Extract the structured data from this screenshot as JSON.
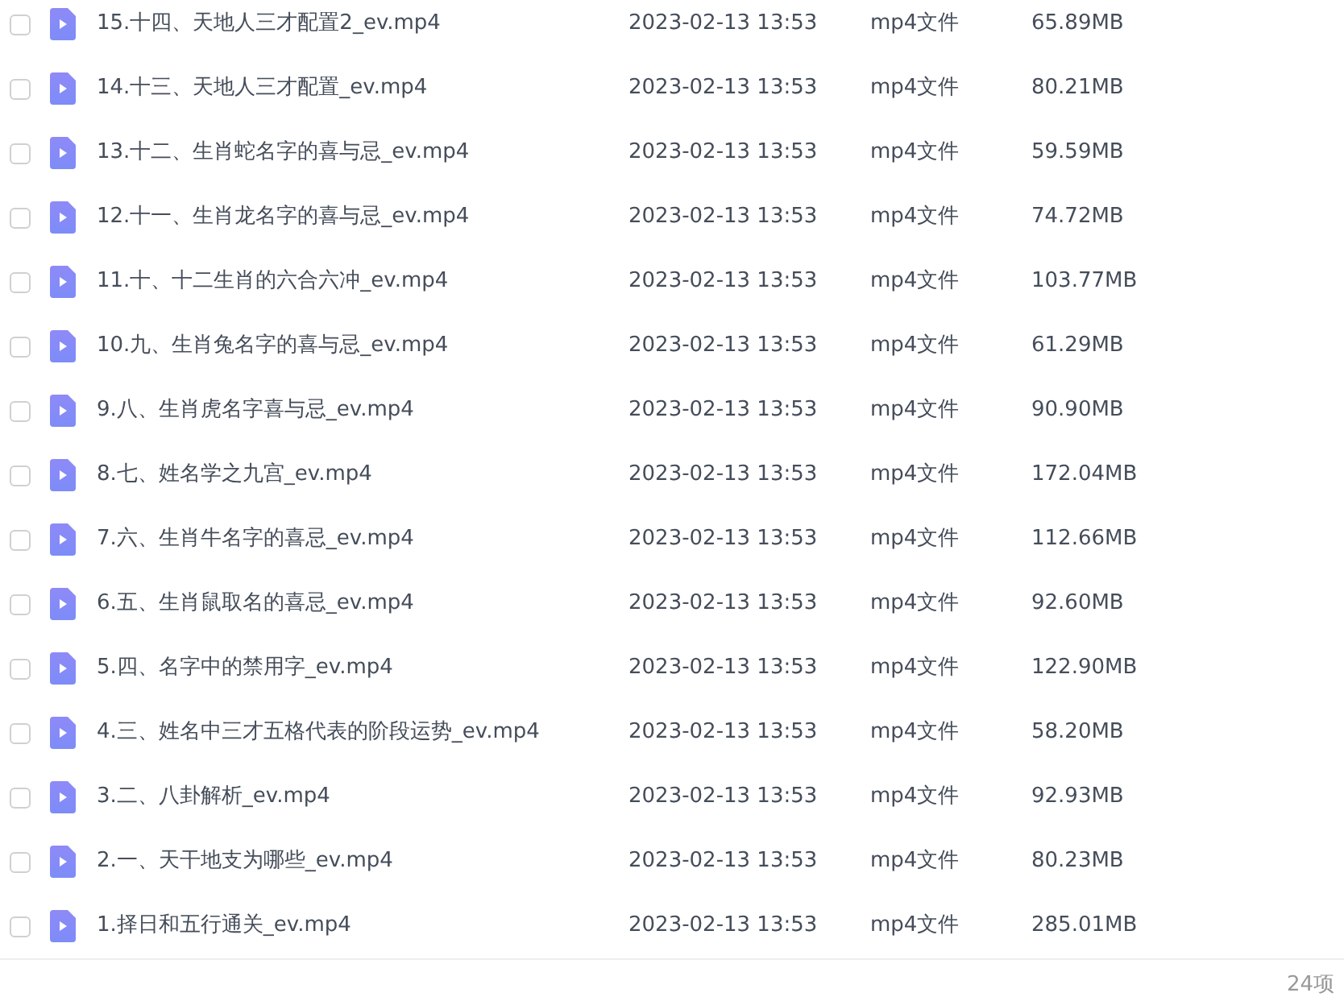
{
  "files": [
    {
      "name": "15.十四、天地人三才配置2_ev.mp4",
      "modified": "2023-02-13 13:53",
      "type": "mp4文件",
      "size": "65.89MB",
      "checked": false
    },
    {
      "name": "14.十三、天地人三才配置_ev.mp4",
      "modified": "2023-02-13 13:53",
      "type": "mp4文件",
      "size": "80.21MB",
      "checked": false
    },
    {
      "name": "13.十二、生肖蛇名字的喜与忌_ev.mp4",
      "modified": "2023-02-13 13:53",
      "type": "mp4文件",
      "size": "59.59MB",
      "checked": false
    },
    {
      "name": "12.十一、生肖龙名字的喜与忌_ev.mp4",
      "modified": "2023-02-13 13:53",
      "type": "mp4文件",
      "size": "74.72MB",
      "checked": false
    },
    {
      "name": "11.十、十二生肖的六合六冲_ev.mp4",
      "modified": "2023-02-13 13:53",
      "type": "mp4文件",
      "size": "103.77MB",
      "checked": false
    },
    {
      "name": "10.九、生肖兔名字的喜与忌_ev.mp4",
      "modified": "2023-02-13 13:53",
      "type": "mp4文件",
      "size": "61.29MB",
      "checked": false
    },
    {
      "name": "9.八、生肖虎名字喜与忌_ev.mp4",
      "modified": "2023-02-13 13:53",
      "type": "mp4文件",
      "size": "90.90MB",
      "checked": false
    },
    {
      "name": "8.七、姓名学之九宫_ev.mp4",
      "modified": "2023-02-13 13:53",
      "type": "mp4文件",
      "size": "172.04MB",
      "checked": false
    },
    {
      "name": "7.六、生肖牛名字的喜忌_ev.mp4",
      "modified": "2023-02-13 13:53",
      "type": "mp4文件",
      "size": "112.66MB",
      "checked": false
    },
    {
      "name": "6.五、生肖鼠取名的喜忌_ev.mp4",
      "modified": "2023-02-13 13:53",
      "type": "mp4文件",
      "size": "92.60MB",
      "checked": false
    },
    {
      "name": "5.四、名字中的禁用字_ev.mp4",
      "modified": "2023-02-13 13:53",
      "type": "mp4文件",
      "size": "122.90MB",
      "checked": false
    },
    {
      "name": "4.三、姓名中三才五格代表的阶段运势_ev.mp4",
      "modified": "2023-02-13 13:53",
      "type": "mp4文件",
      "size": "58.20MB",
      "checked": false
    },
    {
      "name": "3.二、八卦解析_ev.mp4",
      "modified": "2023-02-13 13:53",
      "type": "mp4文件",
      "size": "92.93MB",
      "checked": false
    },
    {
      "name": "2.一、天干地支为哪些_ev.mp4",
      "modified": "2023-02-13 13:53",
      "type": "mp4文件",
      "size": "80.23MB",
      "checked": false
    },
    {
      "name": "1.择日和五行通关_ev.mp4",
      "modified": "2023-02-13 13:53",
      "type": "mp4文件",
      "size": "285.01MB",
      "checked": false
    }
  ],
  "footer": {
    "count": "24项"
  }
}
